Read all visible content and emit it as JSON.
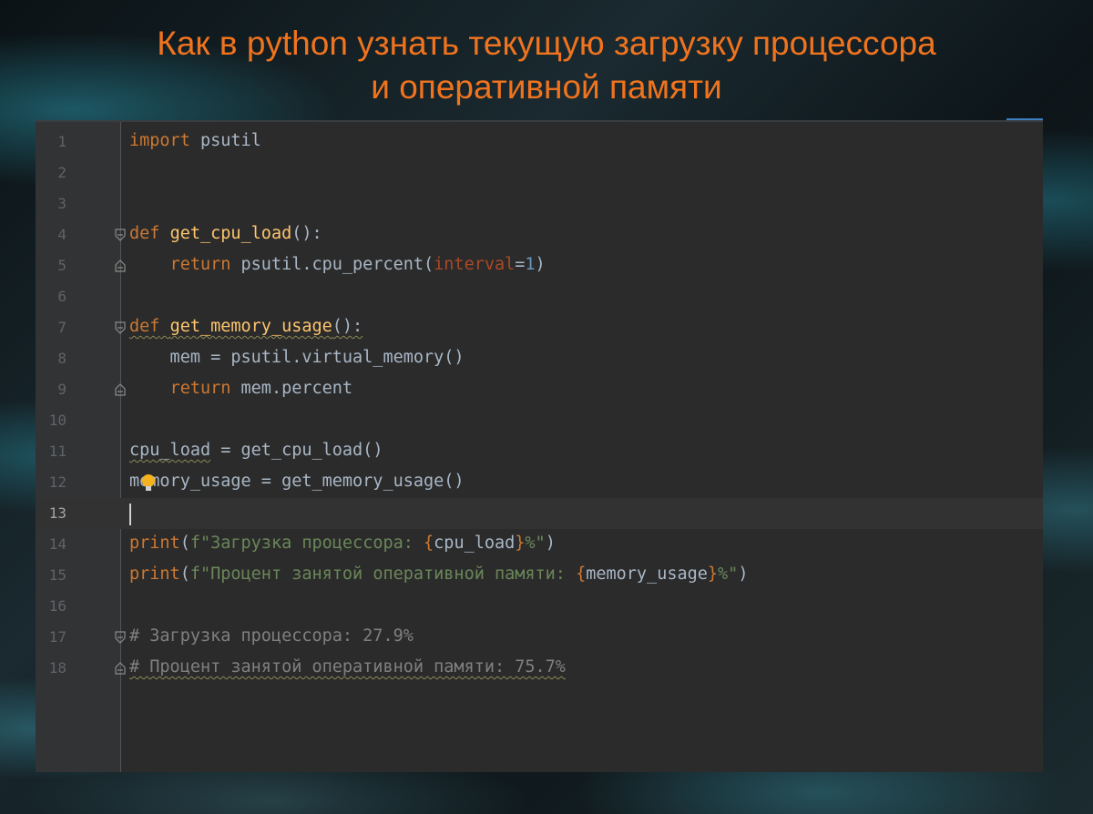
{
  "title_line1": "Как в python узнать текущую загрузку процессора",
  "title_line2": "и оперативной памяти",
  "editor": {
    "current_line": 13,
    "lines": [
      {
        "n": "1",
        "tokens": [
          {
            "t": "import",
            "c": "kw"
          },
          {
            "t": " psutil",
            "c": ""
          }
        ]
      },
      {
        "n": "2",
        "tokens": []
      },
      {
        "n": "3",
        "tokens": []
      },
      {
        "n": "4",
        "fold": "open",
        "tokens": [
          {
            "t": "def",
            "c": "kw"
          },
          {
            "t": " ",
            "c": ""
          },
          {
            "t": "get_cpu_load",
            "c": "fn"
          },
          {
            "t": "():",
            "c": ""
          }
        ]
      },
      {
        "n": "5",
        "fold": "close",
        "tokens": [
          {
            "t": "    ",
            "c": ""
          },
          {
            "t": "return",
            "c": "kw"
          },
          {
            "t": " psutil.cpu_percent(",
            "c": ""
          },
          {
            "t": "interval",
            "c": "param"
          },
          {
            "t": "=",
            "c": ""
          },
          {
            "t": "1",
            "c": "num"
          },
          {
            "t": ")",
            "c": ""
          }
        ]
      },
      {
        "n": "6",
        "tokens": []
      },
      {
        "n": "7",
        "fold": "open",
        "tokens": [
          {
            "t": "def get_memory_usage():",
            "c": "squig-group"
          }
        ]
      },
      {
        "n": "8",
        "tokens": [
          {
            "t": "    mem = psutil.virtual_memory()",
            "c": ""
          }
        ]
      },
      {
        "n": "9",
        "fold": "close",
        "tokens": [
          {
            "t": "    ",
            "c": ""
          },
          {
            "t": "return",
            "c": "kw"
          },
          {
            "t": " mem.percent",
            "c": ""
          }
        ]
      },
      {
        "n": "10",
        "tokens": []
      },
      {
        "n": "11",
        "tokens": [
          {
            "t": "cpu_load",
            "c": "squig"
          },
          {
            "t": " = get_cpu_load()",
            "c": ""
          }
        ]
      },
      {
        "n": "12",
        "tokens": [
          {
            "t": "memory_usage = get_memory_usage()",
            "c": ""
          }
        ]
      },
      {
        "n": "13",
        "tokens": []
      },
      {
        "n": "14",
        "tokens": [
          {
            "t": "print",
            "c": "kw"
          },
          {
            "t": "(",
            "c": ""
          },
          {
            "t": "f\"Загрузка процессора: ",
            "c": "str"
          },
          {
            "t": "{",
            "c": "kw"
          },
          {
            "t": "cpu_load",
            "c": ""
          },
          {
            "t": "}",
            "c": "kw"
          },
          {
            "t": "%\"",
            "c": "str"
          },
          {
            "t": ")",
            "c": ""
          }
        ]
      },
      {
        "n": "15",
        "tokens": [
          {
            "t": "print",
            "c": "kw"
          },
          {
            "t": "(",
            "c": ""
          },
          {
            "t": "f\"Процент занятой оперативной памяти: ",
            "c": "str"
          },
          {
            "t": "{",
            "c": "kw"
          },
          {
            "t": "memory_usage",
            "c": ""
          },
          {
            "t": "}",
            "c": "kw"
          },
          {
            "t": "%\"",
            "c": "str"
          },
          {
            "t": ")",
            "c": ""
          }
        ]
      },
      {
        "n": "16",
        "tokens": []
      },
      {
        "n": "17",
        "fold": "open",
        "tokens": [
          {
            "t": "# Загрузка процессора: 27.9%",
            "c": "cmt"
          }
        ]
      },
      {
        "n": "18",
        "fold": "close",
        "tokens": [
          {
            "t": "# Процент занятой оперативной памяти: 75.7%",
            "c": "cmt squig"
          }
        ]
      }
    ]
  }
}
